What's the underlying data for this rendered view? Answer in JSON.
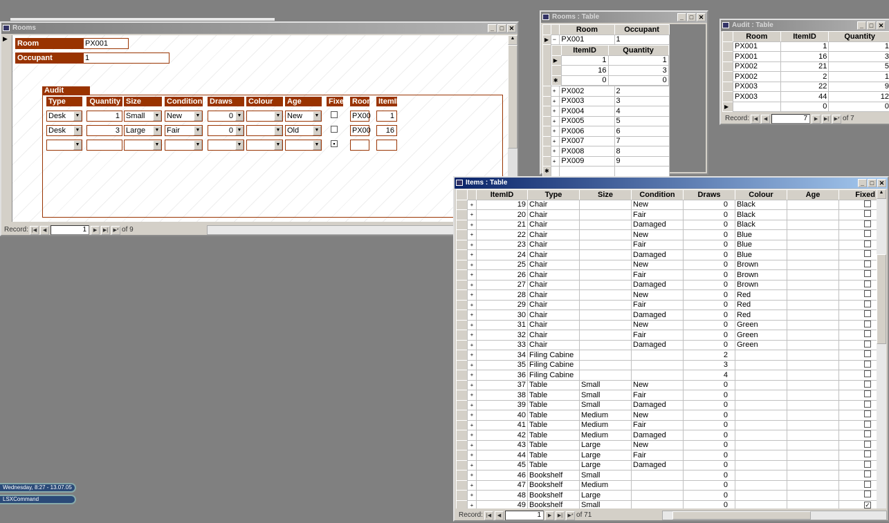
{
  "rooms_form": {
    "title": "Rooms",
    "room_label": "Room",
    "room_value": "PX001",
    "occupant_label": "Occupant",
    "occupant_value": "1",
    "subform_label": "Audit subform",
    "sub_headers": [
      "Type",
      "Quantity",
      "Size",
      "Condition",
      "Draws",
      "Colour",
      "Age",
      "Fixed",
      "Room",
      "ItemID"
    ],
    "sub_rows": [
      {
        "type": "Desk",
        "quantity": "1",
        "size": "Small",
        "condition": "New",
        "draws": "0",
        "colour": "",
        "age": "New",
        "fixed": false,
        "room": "PX00",
        "itemid": "1"
      },
      {
        "type": "Desk",
        "quantity": "3",
        "size": "Large",
        "condition": "Fair",
        "draws": "0",
        "colour": "",
        "age": "Old",
        "fixed": false,
        "room": "PX00",
        "itemid": "16"
      }
    ],
    "nav": {
      "label": "Record:",
      "current": "1",
      "of": "of 9"
    }
  },
  "rooms_table": {
    "title": "Rooms : Table",
    "headers": [
      "Room",
      "Occupant"
    ],
    "expanded": {
      "room": "PX001",
      "occupant": "1",
      "sub_headers": [
        "ItemID",
        "Quantity"
      ],
      "sub_rows": [
        [
          "1",
          "1"
        ],
        [
          "16",
          "3"
        ],
        [
          "0",
          "0"
        ]
      ]
    },
    "rows": [
      [
        "PX002",
        "2"
      ],
      [
        "PX003",
        "3"
      ],
      [
        "PX004",
        "4"
      ],
      [
        "PX005",
        "5"
      ],
      [
        "PX006",
        "6"
      ],
      [
        "PX007",
        "7"
      ],
      [
        "PX008",
        "8"
      ],
      [
        "PX009",
        "9"
      ]
    ]
  },
  "audit_table": {
    "title": "Audit : Table",
    "headers": [
      "Room",
      "ItemID",
      "Quantity"
    ],
    "rows": [
      [
        "PX001",
        "1",
        "1"
      ],
      [
        "PX001",
        "16",
        "3"
      ],
      [
        "PX002",
        "21",
        "5"
      ],
      [
        "PX002",
        "2",
        "1"
      ],
      [
        "PX003",
        "22",
        "9"
      ],
      [
        "PX003",
        "44",
        "12"
      ],
      [
        "",
        "0",
        "0"
      ]
    ],
    "nav": {
      "label": "Record:",
      "current": "7",
      "of": "of 7"
    }
  },
  "items_table": {
    "title": "Items : Table",
    "headers": [
      "ItemID",
      "Type",
      "Size",
      "Condition",
      "Draws",
      "Colour",
      "Age",
      "Fixed"
    ],
    "rows": [
      [
        "19",
        "Chair",
        "",
        "New",
        "0",
        "Black",
        "",
        false
      ],
      [
        "20",
        "Chair",
        "",
        "Fair",
        "0",
        "Black",
        "",
        false
      ],
      [
        "21",
        "Chair",
        "",
        "Damaged",
        "0",
        "Black",
        "",
        false
      ],
      [
        "22",
        "Chair",
        "",
        "New",
        "0",
        "Blue",
        "",
        false
      ],
      [
        "23",
        "Chair",
        "",
        "Fair",
        "0",
        "Blue",
        "",
        false
      ],
      [
        "24",
        "Chair",
        "",
        "Damaged",
        "0",
        "Blue",
        "",
        false
      ],
      [
        "25",
        "Chair",
        "",
        "New",
        "0",
        "Brown",
        "",
        false
      ],
      [
        "26",
        "Chair",
        "",
        "Fair",
        "0",
        "Brown",
        "",
        false
      ],
      [
        "27",
        "Chair",
        "",
        "Damaged",
        "0",
        "Brown",
        "",
        false
      ],
      [
        "28",
        "Chair",
        "",
        "New",
        "0",
        "Red",
        "",
        false
      ],
      [
        "29",
        "Chair",
        "",
        "Fair",
        "0",
        "Red",
        "",
        false
      ],
      [
        "30",
        "Chair",
        "",
        "Damaged",
        "0",
        "Red",
        "",
        false
      ],
      [
        "31",
        "Chair",
        "",
        "New",
        "0",
        "Green",
        "",
        false
      ],
      [
        "32",
        "Chair",
        "",
        "Fair",
        "0",
        "Green",
        "",
        false
      ],
      [
        "33",
        "Chair",
        "",
        "Damaged",
        "0",
        "Green",
        "",
        false
      ],
      [
        "34",
        "Filing Cabine",
        "",
        "",
        "2",
        "",
        "",
        false
      ],
      [
        "35",
        "Filing Cabine",
        "",
        "",
        "3",
        "",
        "",
        false
      ],
      [
        "36",
        "Filing Cabine",
        "",
        "",
        "4",
        "",
        "",
        false
      ],
      [
        "37",
        "Table",
        "Small",
        "New",
        "0",
        "",
        "",
        false
      ],
      [
        "38",
        "Table",
        "Small",
        "Fair",
        "0",
        "",
        "",
        false
      ],
      [
        "39",
        "Table",
        "Small",
        "Damaged",
        "0",
        "",
        "",
        false
      ],
      [
        "40",
        "Table",
        "Medium",
        "New",
        "0",
        "",
        "",
        false
      ],
      [
        "41",
        "Table",
        "Medium",
        "Fair",
        "0",
        "",
        "",
        false
      ],
      [
        "42",
        "Table",
        "Medium",
        "Damaged",
        "0",
        "",
        "",
        false
      ],
      [
        "43",
        "Table",
        "Large",
        "New",
        "0",
        "",
        "",
        false
      ],
      [
        "44",
        "Table",
        "Large",
        "Fair",
        "0",
        "",
        "",
        false
      ],
      [
        "45",
        "Table",
        "Large",
        "Damaged",
        "0",
        "",
        "",
        false
      ],
      [
        "46",
        "Bookshelf",
        "Small",
        "",
        "0",
        "",
        "",
        false
      ],
      [
        "47",
        "Bookshelf",
        "Medium",
        "",
        "0",
        "",
        "",
        false
      ],
      [
        "48",
        "Bookshelf",
        "Large",
        "",
        "0",
        "",
        "",
        false
      ],
      [
        "49",
        "Bookshelf",
        "Small",
        "",
        "0",
        "",
        "",
        true
      ]
    ],
    "nav": {
      "label": "Record:",
      "current": "1",
      "of": "of 71"
    }
  },
  "taskbar": {
    "clock": "Wednesday, 8:27 - 13.07.05",
    "command": "LSXCommand"
  }
}
